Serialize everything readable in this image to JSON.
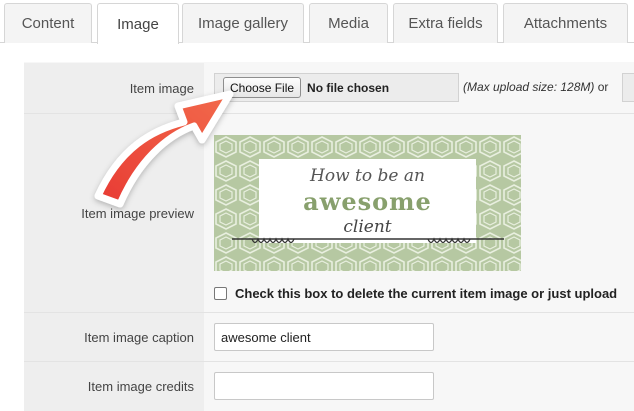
{
  "tabs": [
    {
      "label": "Content",
      "active": false
    },
    {
      "label": "Image",
      "active": true
    },
    {
      "label": "Image gallery",
      "active": false
    },
    {
      "label": "Media",
      "active": false
    },
    {
      "label": "Extra fields",
      "active": false
    },
    {
      "label": "Attachments",
      "active": false
    }
  ],
  "form": {
    "item_image_label": "Item image",
    "choose_file_label": "Choose File",
    "no_file_text": "No file chosen",
    "max_upload_note": "(Max upload size: 128M)",
    "or_text": "or",
    "preview_label": "Item image preview",
    "delete_checkbox_label": "Check this box to delete the current item image or just upload",
    "caption_label": "Item image caption",
    "caption_value": "awesome client",
    "credits_label": "Item image credits",
    "credits_value": ""
  },
  "preview_image": {
    "line1": "How to be an",
    "line2": "awesome",
    "line3": "client"
  },
  "colors": {
    "arrow": "#ec4a3a",
    "preview_bg": "#b6c8a2",
    "accent_green": "#88a06d"
  }
}
